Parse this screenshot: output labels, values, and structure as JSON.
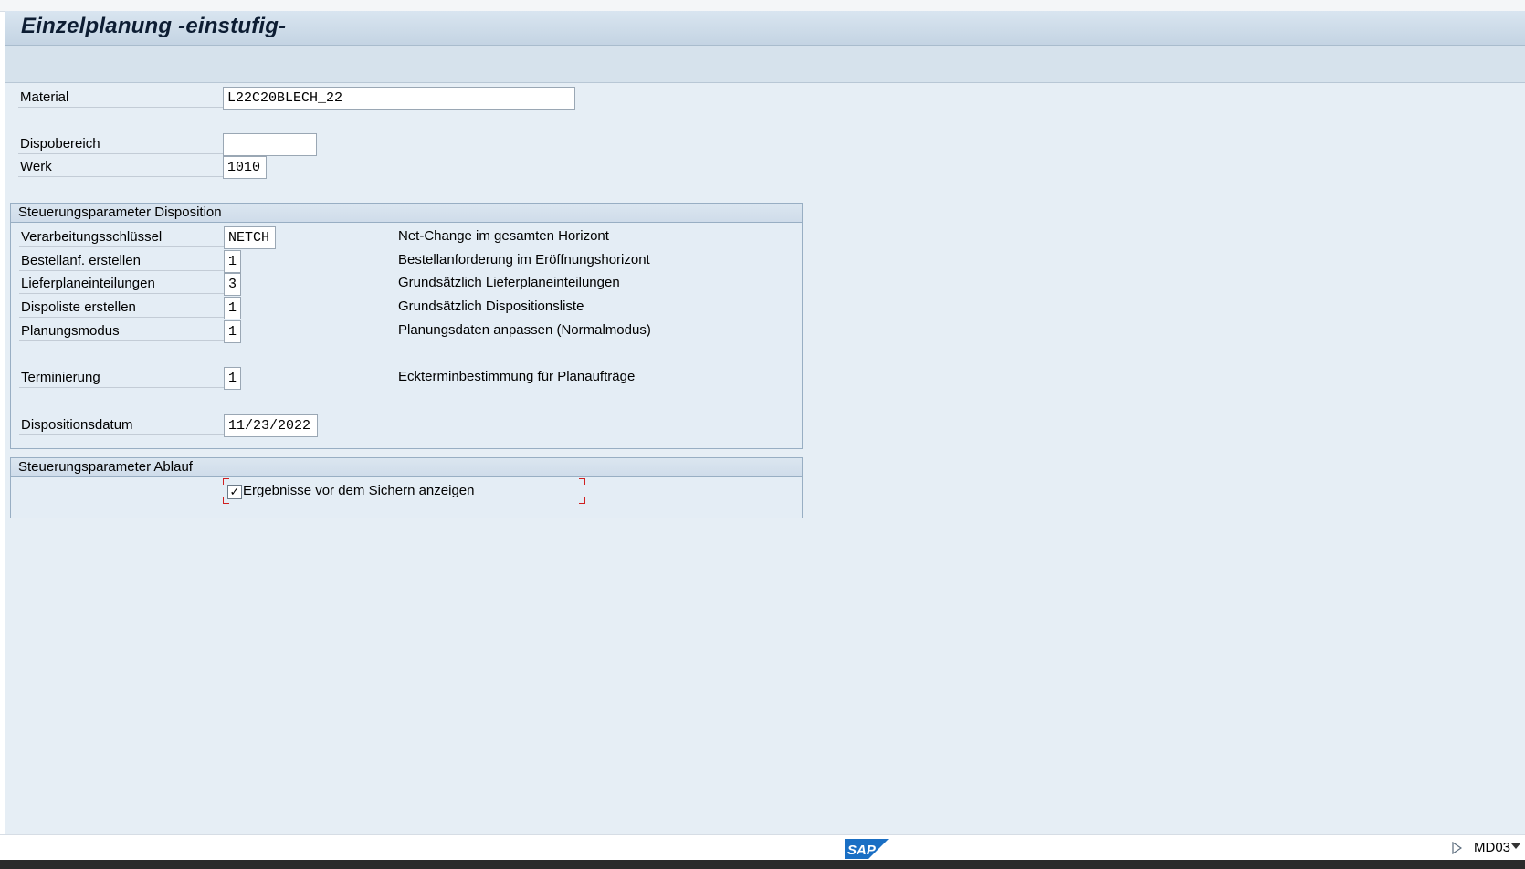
{
  "title": "Einzelplanung -einstufig-",
  "selection": {
    "material": {
      "label": "Material",
      "value": "L22C20BLECH_22"
    },
    "dispobereich": {
      "label": "Dispobereich",
      "value": ""
    },
    "werk": {
      "label": "Werk",
      "value": "1010"
    }
  },
  "group_disposition": {
    "title": "Steuerungsparameter Disposition",
    "rows": [
      {
        "label": "Verarbeitungsschlüssel",
        "value": "NETCH",
        "desc": "Net-Change im gesamten Horizont"
      },
      {
        "label": "Bestellanf. erstellen",
        "value": "1",
        "desc": "Bestellanforderung im Eröffnungshorizont"
      },
      {
        "label": "Lieferplaneinteilungen",
        "value": "3",
        "desc": "Grundsätzlich Lieferplaneinteilungen"
      },
      {
        "label": "Dispoliste erstellen",
        "value": "1",
        "desc": "Grundsätzlich Dispositionsliste"
      },
      {
        "label": "Planungsmodus",
        "value": "1",
        "desc": "Planungsdaten anpassen (Normalmodus)"
      },
      {
        "label": "Terminierung",
        "value": "1",
        "desc": "Eckterminbestimmung für Planaufträge"
      },
      {
        "label": "Dispositionsdatum",
        "value": "11/23/2022",
        "desc": ""
      }
    ]
  },
  "group_ablauf": {
    "title": "Steuerungsparameter Ablauf",
    "checkbox_label": "Ergebnisse vor dem Sichern anzeigen",
    "checkbox_checked": true,
    "check_glyph": "✓"
  },
  "statusbar": {
    "logo_text": "SAP",
    "transaction": "MD03"
  },
  "colors": {
    "title_text": "#0d1d33",
    "sap_blue": "#1a6fc4",
    "focus_frame": "#d02020"
  }
}
